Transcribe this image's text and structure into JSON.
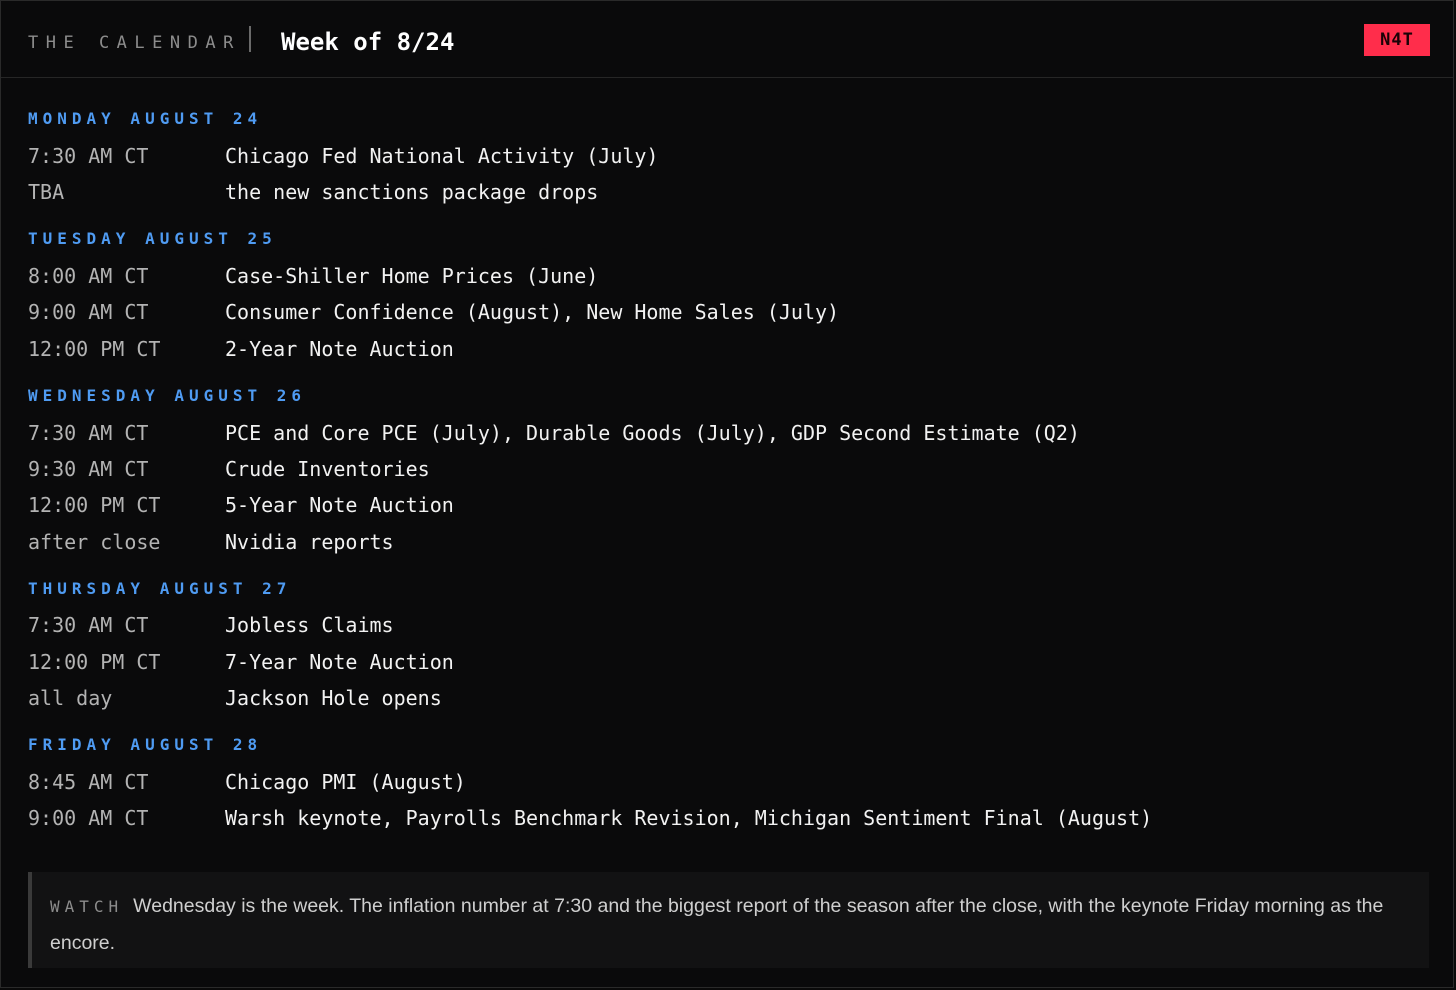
{
  "header": {
    "brand": "THE CALENDAR",
    "title": "Week of 8/24",
    "badge": "N4T"
  },
  "days": [
    {
      "heading": "MONDAY AUGUST 24",
      "events": [
        {
          "time": "7:30 AM CT",
          "name": "Chicago Fed National Activity (July)"
        },
        {
          "time": "TBA",
          "name": "the new sanctions package drops"
        }
      ]
    },
    {
      "heading": "TUESDAY AUGUST 25",
      "events": [
        {
          "time": "8:00 AM CT",
          "name": "Case-Shiller Home Prices (June)"
        },
        {
          "time": "9:00 AM CT",
          "name": "Consumer Confidence (August), New Home Sales (July)"
        },
        {
          "time": "12:00 PM CT",
          "name": "2-Year Note Auction"
        }
      ]
    },
    {
      "heading": "WEDNESDAY AUGUST 26",
      "events": [
        {
          "time": "7:30 AM CT",
          "name": "PCE and Core PCE (July), Durable Goods (July), GDP Second Estimate (Q2)"
        },
        {
          "time": "9:30 AM CT",
          "name": "Crude Inventories"
        },
        {
          "time": "12:00 PM CT",
          "name": "5-Year Note Auction"
        },
        {
          "time": "after close",
          "name": "Nvidia reports"
        }
      ]
    },
    {
      "heading": "THURSDAY AUGUST 27",
      "events": [
        {
          "time": "7:30 AM CT",
          "name": "Jobless Claims"
        },
        {
          "time": "12:00 PM CT",
          "name": "7-Year Note Auction"
        },
        {
          "time": "all day",
          "name": "Jackson Hole opens"
        }
      ]
    },
    {
      "heading": "FRIDAY AUGUST 28",
      "events": [
        {
          "time": "8:45 AM CT",
          "name": "Chicago PMI (August)"
        },
        {
          "time": "9:00 AM CT",
          "name": "Warsh keynote, Payrolls Benchmark Revision, Michigan Sentiment Final (August)"
        }
      ]
    }
  ],
  "watch": {
    "label": "WATCH",
    "text": "Wednesday is the week. The inflation number at 7:30 and the biggest report of the season after the close, with the keynote Friday morning as the encore."
  },
  "colors": {
    "day_heading": "#4f9bf2",
    "badge": "#ff2d4b"
  }
}
